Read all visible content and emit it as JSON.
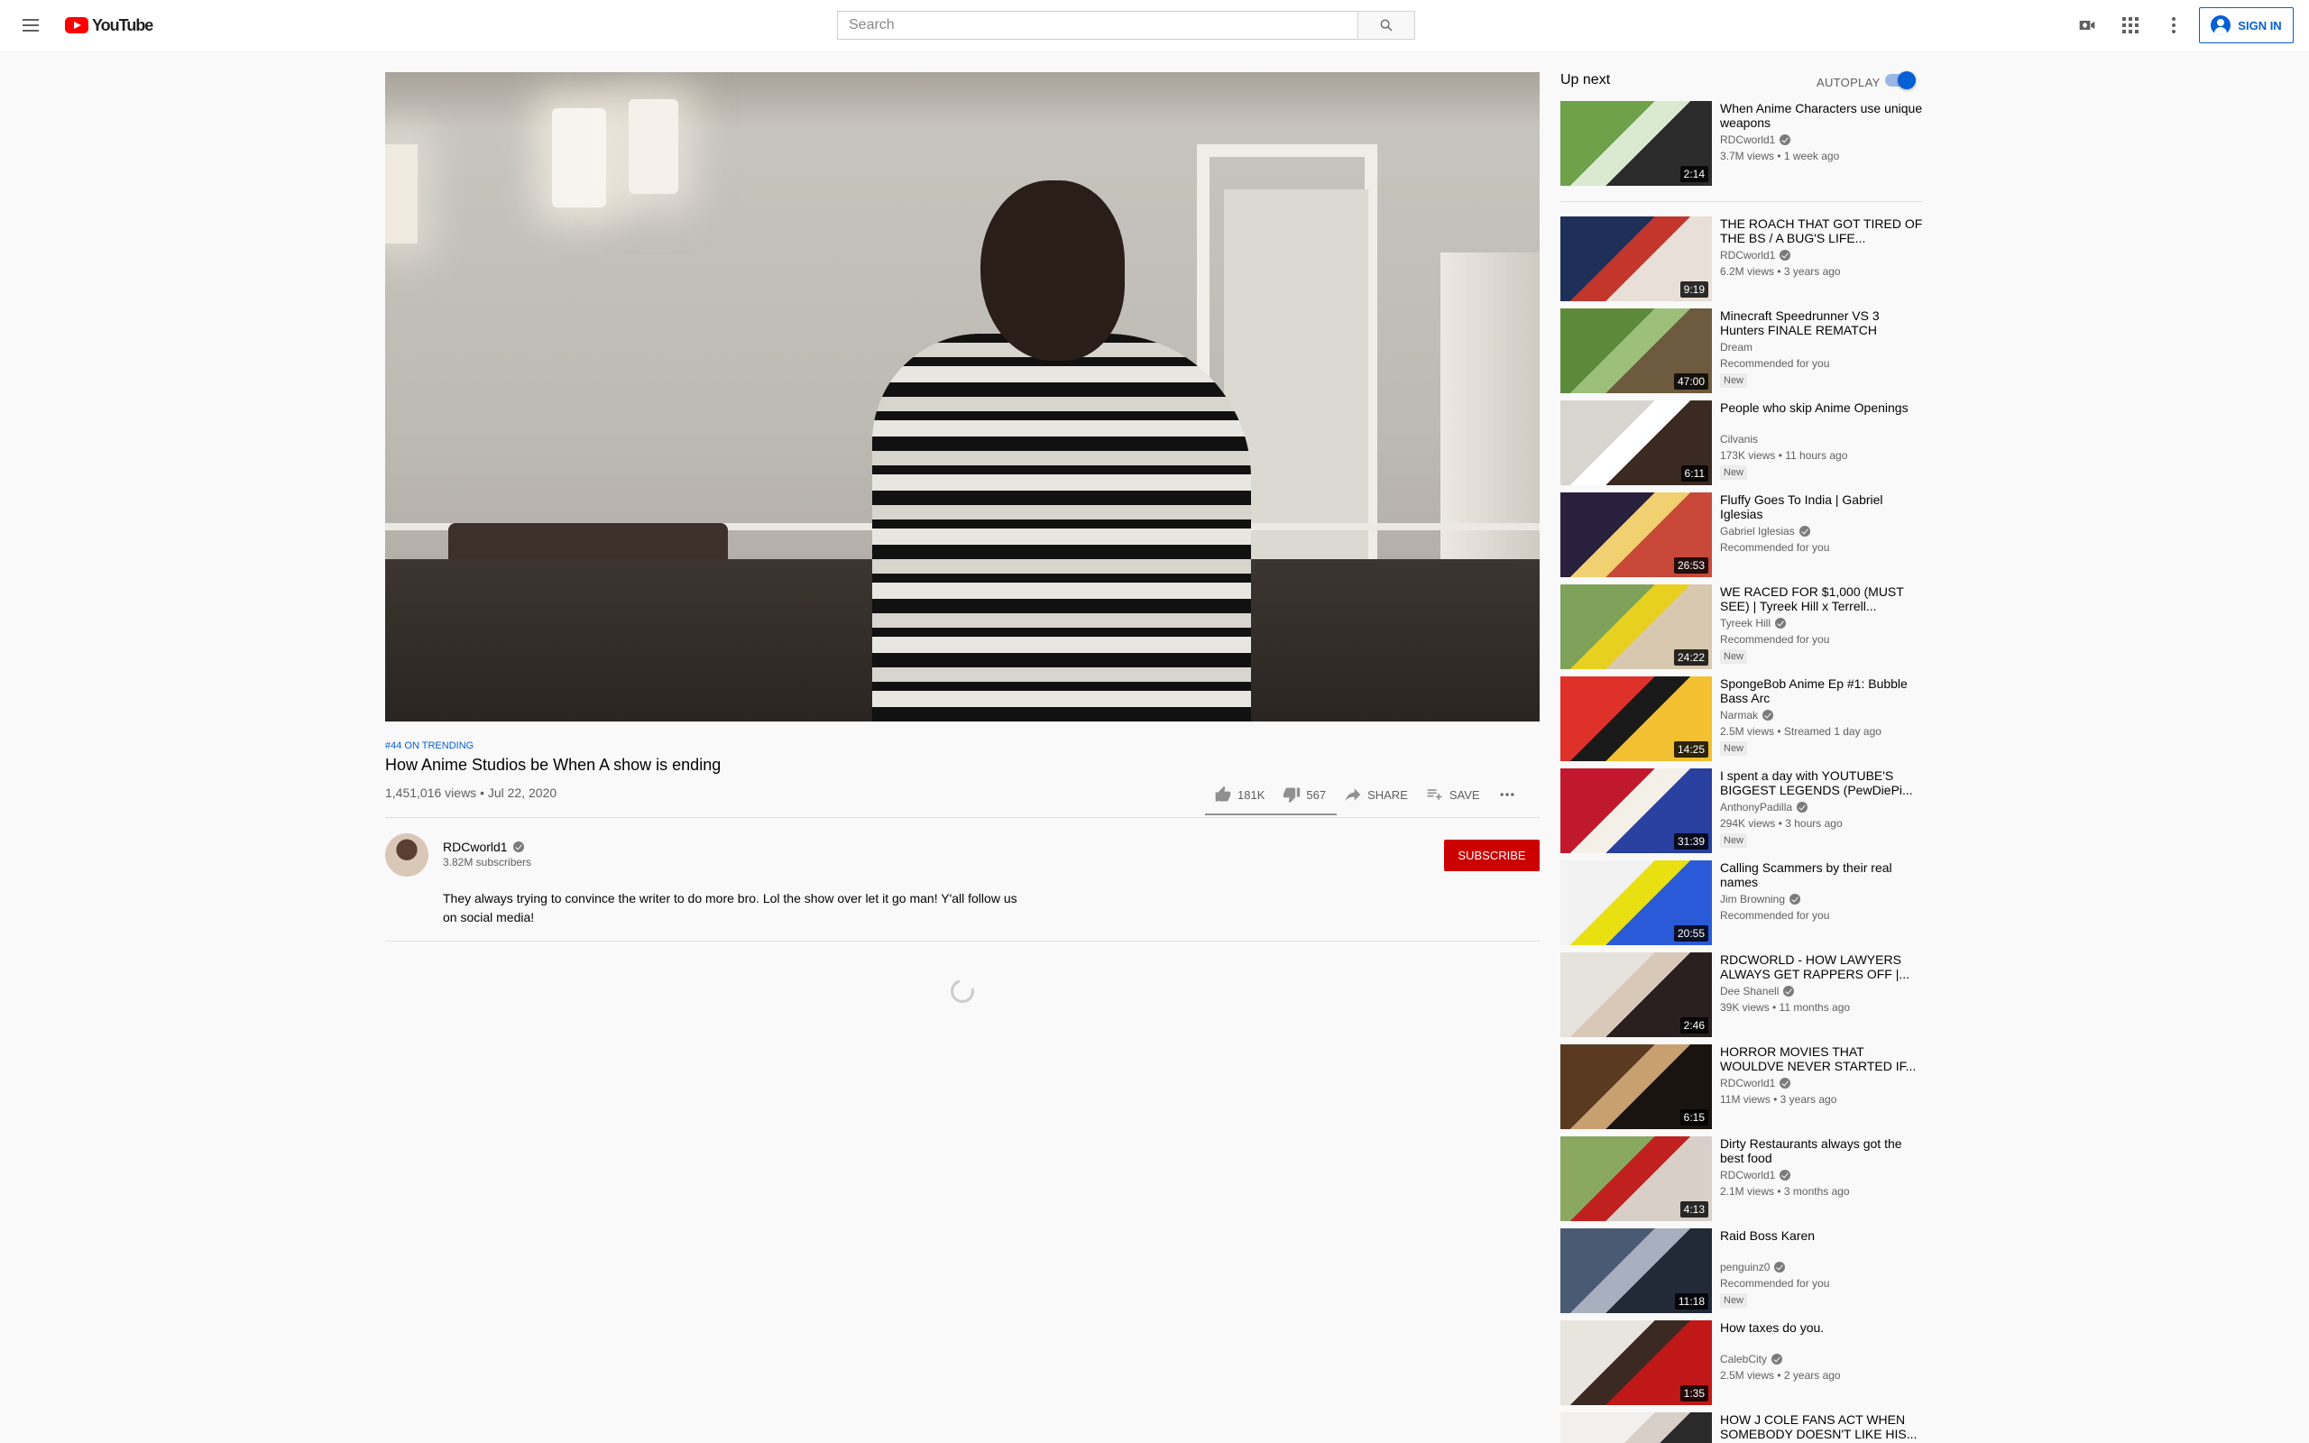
{
  "header": {
    "logo_text": "YouTube",
    "search_placeholder": "Search",
    "signin_label": "SIGN IN"
  },
  "video": {
    "trending_label": "#44 ON TRENDING",
    "title": "How Anime Studios be When A show is ending",
    "views_date": "1,451,016 views • Jul 22, 2020",
    "like_count": "181K",
    "dislike_count": "567",
    "like_ratio": 0.997,
    "share_label": "SHARE",
    "save_label": "SAVE"
  },
  "owner": {
    "name": "RDCworld1",
    "subscribers": "3.82M subscribers",
    "subscribe_label": "SUBSCRIBE",
    "description": "They always trying to convince the writer to do more bro. Lol the show over let it go man! Y'all follow us on social media!"
  },
  "sidebar": {
    "up_next_label": "Up next",
    "autoplay_label": "AUTOPLAY",
    "autoplay_on": true,
    "items": [
      {
        "title": "When Anime Characters use unique weapons",
        "channel": "RDCworld1",
        "verified": true,
        "meta": "3.7M views • 1 week ago",
        "duration": "2:14",
        "badge": "",
        "colors": [
          "#6fa04a",
          "#2c2c2c",
          "#d9ead0"
        ]
      },
      {
        "title": "THE ROACH THAT GOT TIRED OF THE BS / A BUG'S LIFE...",
        "channel": "RDCworld1",
        "verified": true,
        "meta": "6.2M views • 3 years ago",
        "duration": "9:19",
        "badge": "",
        "colors": [
          "#1e2f5a",
          "#e8e0d8",
          "#c2362c"
        ]
      },
      {
        "title": "Minecraft Speedrunner VS 3 Hunters FINALE REMATCH",
        "channel": "Dream",
        "verified": false,
        "meta": "Recommended for you",
        "duration": "47:00",
        "badge": "New",
        "colors": [
          "#5d8a3a",
          "#6e5a3e",
          "#9cc07a"
        ]
      },
      {
        "title": "People who skip Anime Openings",
        "channel": "Cilvanis",
        "verified": false,
        "meta": "173K views • 11 hours ago",
        "duration": "6:11",
        "badge": "New",
        "colors": [
          "#d8d4d0",
          "#3a2a22",
          "#ffffff"
        ]
      },
      {
        "title": "Fluffy Goes To India | Gabriel Iglesias",
        "channel": "Gabriel Iglesias",
        "verified": true,
        "meta": "Recommended for you",
        "duration": "26:53",
        "badge": "",
        "colors": [
          "#2a1f3d",
          "#c8493a",
          "#f0d070"
        ]
      },
      {
        "title": "WE RACED FOR $1,000 (MUST SEE) | Tyreek Hill x Terrell...",
        "channel": "Tyreek Hill",
        "verified": true,
        "meta": "Recommended for you",
        "duration": "24:22",
        "badge": "New",
        "colors": [
          "#7fa25a",
          "#d8c8b0",
          "#e8d020"
        ]
      },
      {
        "title": "SpongeBob Anime Ep #1: Bubble Bass Arc",
        "channel": "Narmak",
        "verified": true,
        "meta": "2.5M views • Streamed 1 day ago",
        "duration": "14:25",
        "badge": "New",
        "colors": [
          "#e0302a",
          "#f2c030",
          "#1a1a1a"
        ]
      },
      {
        "title": "I spent a day with YOUTUBE'S BIGGEST LEGENDS (PewDiePi...",
        "channel": "AnthonyPadilla",
        "verified": true,
        "meta": "294K views • 3 hours ago",
        "duration": "31:39",
        "badge": "New",
        "colors": [
          "#c2182e",
          "#2a40a0",
          "#f4f0e8"
        ]
      },
      {
        "title": "Calling Scammers by their real names",
        "channel": "Jim Browning",
        "verified": true,
        "meta": "Recommended for you",
        "duration": "20:55",
        "badge": "",
        "colors": [
          "#f2f2f2",
          "#2a5ad8",
          "#e8e010"
        ]
      },
      {
        "title": "RDCWORLD - HOW LAWYERS ALWAYS GET RAPPERS OFF |...",
        "channel": "Dee Shanell",
        "verified": true,
        "meta": "39K views • 11 months ago",
        "duration": "2:46",
        "badge": "",
        "colors": [
          "#e6e2dc",
          "#2a2020",
          "#d8c8b8"
        ]
      },
      {
        "title": "HORROR MOVIES THAT WOULDVE NEVER STARTED IF...",
        "channel": "RDCworld1",
        "verified": true,
        "meta": "11M views • 3 years ago",
        "duration": "6:15",
        "badge": "",
        "colors": [
          "#5a3a20",
          "#1a1410",
          "#c8a070"
        ]
      },
      {
        "title": "Dirty Restaurants always got the best food",
        "channel": "RDCworld1",
        "verified": true,
        "meta": "2.1M views • 3 months ago",
        "duration": "4:13",
        "badge": "",
        "colors": [
          "#8aa860",
          "#d8d0c8",
          "#c02020"
        ]
      },
      {
        "title": "Raid Boss Karen",
        "channel": "penguinz0",
        "verified": true,
        "meta": "Recommended for you",
        "duration": "11:18",
        "badge": "New",
        "colors": [
          "#4a5a72",
          "#222a38",
          "#a8b0c0"
        ]
      },
      {
        "title": "How taxes do you.",
        "channel": "CalebCity",
        "verified": true,
        "meta": "2.5M views • 2 years ago",
        "duration": "1:35",
        "badge": "",
        "colors": [
          "#e8e4de",
          "#c01818",
          "#3a2a22"
        ]
      },
      {
        "title": "HOW J COLE FANS ACT WHEN SOMEBODY DOESN'T LIKE HIS...",
        "channel": "",
        "verified": false,
        "meta": "",
        "duration": "",
        "badge": "",
        "colors": [
          "#f2f0ee",
          "#2a2a2a",
          "#d8d0c8"
        ]
      }
    ]
  }
}
